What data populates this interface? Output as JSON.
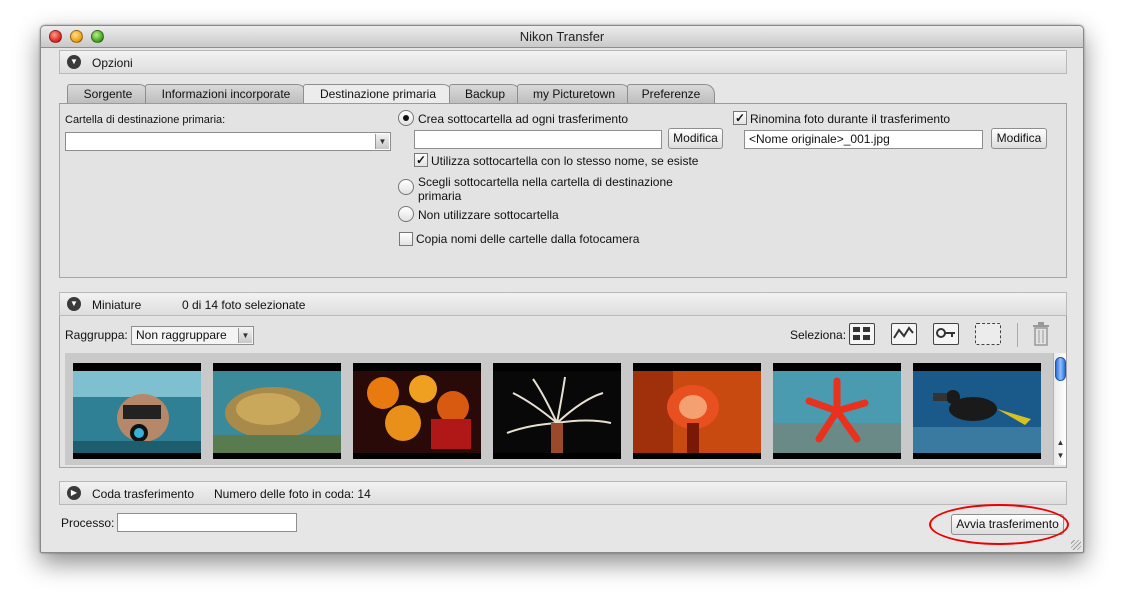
{
  "window": {
    "title": "Nikon Transfer"
  },
  "options_panel": {
    "label": "Opzioni",
    "tabs": [
      {
        "label": "Sorgente",
        "active": false
      },
      {
        "label": "Informazioni incorporate",
        "active": false
      },
      {
        "label": "Destinazione primaria",
        "active": true
      },
      {
        "label": "Backup",
        "active": false
      },
      {
        "label": "my Picturetown",
        "active": false
      },
      {
        "label": "Preferenze",
        "active": false
      }
    ],
    "dest_folder_label": "Cartella di destinazione primaria:",
    "dest_folder_value": "",
    "radio_create": {
      "label": "Crea sottocartella ad ogni trasferimento",
      "checked": true
    },
    "subfolder_name_value": "",
    "modify_label": "Modifica",
    "use_same_name": {
      "label": "Utilizza sottocartella con lo stesso nome, se esiste",
      "checked": true
    },
    "radio_choose": {
      "label_line1": "Scegli sottocartella nella cartella di destinazione",
      "label_line2": "primaria",
      "checked": false
    },
    "radio_none": {
      "label": "Non utilizzare sottocartella",
      "checked": false
    },
    "copy_names": {
      "label": "Copia nomi delle cartelle dalla fotocamera",
      "checked": false
    },
    "rename": {
      "label": "Rinomina foto durante il trasferimento",
      "checked": true
    },
    "rename_value": "<Nome originale>_001.jpg",
    "rename_modify_label": "Modifica"
  },
  "thumbnails_panel": {
    "label": "Miniature",
    "selection_count": "0 di 14 foto selezionate",
    "group_label": "Raggruppa:",
    "group_value": "Non raggruppare",
    "select_label": "Seleziona:",
    "select_icons": [
      "select-all-icon",
      "select-tagged-icon",
      "select-protected-icon",
      "deselect-all-icon"
    ],
    "delete_icon": "trash-icon",
    "thumbnails": [
      {
        "icon": "photo-snorkeler-camera"
      },
      {
        "icon": "photo-coral-reef"
      },
      {
        "icon": "photo-orange-coral"
      },
      {
        "icon": "photo-tube-worm"
      },
      {
        "icon": "photo-red-fan-worm"
      },
      {
        "icon": "photo-red-starfish"
      },
      {
        "icon": "photo-scuba-diver"
      }
    ]
  },
  "queue_panel": {
    "label": "Coda trasferimento",
    "queue_count": "Numero delle foto in coda: 14"
  },
  "footer": {
    "process_label": "Processo:",
    "process_value": "",
    "start_transfer_label": "Avvia trasferimento"
  },
  "colors": {
    "window_bg": "#e6e6e6",
    "annotation_red": "#e00000",
    "scroll_blue": "#2c6fd6"
  }
}
